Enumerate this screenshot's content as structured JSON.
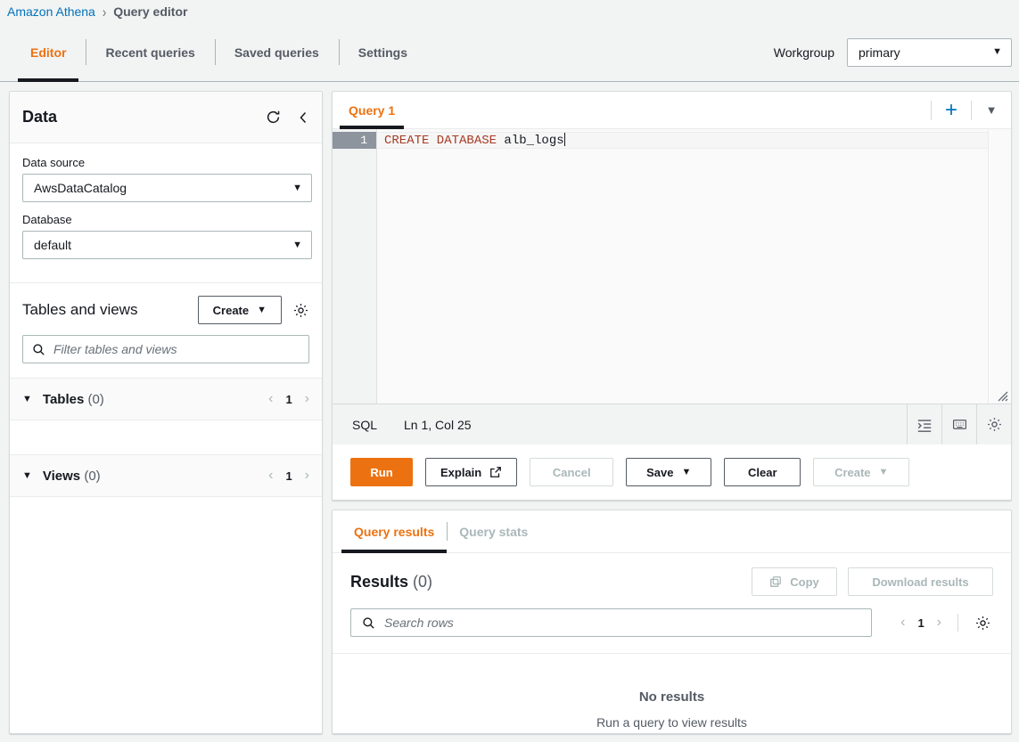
{
  "breadcrumb": {
    "root": "Amazon Athena",
    "separator": "›",
    "current": "Query editor"
  },
  "topbar": {
    "tabs": [
      {
        "label": "Editor",
        "active": true
      },
      {
        "label": "Recent queries",
        "active": false
      },
      {
        "label": "Saved queries",
        "active": false
      },
      {
        "label": "Settings",
        "active": false
      }
    ],
    "workgroup_label": "Workgroup",
    "workgroup_value": "primary"
  },
  "sidebar": {
    "title": "Data",
    "refresh_icon": "refresh-icon",
    "collapse_icon": "chevron-left-icon",
    "data_source_label": "Data source",
    "data_source_value": "AwsDataCatalog",
    "database_label": "Database",
    "database_value": "default",
    "tables_views_title": "Tables and views",
    "create_button": "Create",
    "settings_icon": "gear-icon",
    "filter_placeholder": "Filter tables and views",
    "groups": [
      {
        "name": "Tables",
        "count": "(0)",
        "page": "1"
      },
      {
        "name": "Views",
        "count": "(0)",
        "page": "1"
      }
    ]
  },
  "editor": {
    "tab_label": "Query 1",
    "add_tab_icon": "plus-icon",
    "tab_menu_icon": "chevron-down-icon",
    "line_number": "1",
    "code_keyword": "CREATE DATABASE ",
    "code_identifier": "alb_logs",
    "status_language": "SQL",
    "status_position": "Ln 1, Col 25",
    "status_icons": [
      "format-indent-icon",
      "keyboard-icon",
      "gear-icon"
    ]
  },
  "actions": {
    "run": "Run",
    "explain": "Explain",
    "explain_icon": "external-link-icon",
    "cancel": "Cancel",
    "save": "Save",
    "clear": "Clear",
    "create": "Create"
  },
  "results": {
    "tabs": [
      {
        "label": "Query results",
        "active": true,
        "disabled": false
      },
      {
        "label": "Query stats",
        "active": false,
        "disabled": true
      }
    ],
    "title": "Results",
    "count": "(0)",
    "copy_button": "Copy",
    "copy_icon": "copy-icon",
    "download_button": "Download results",
    "search_placeholder": "Search rows",
    "search_icon": "search-icon",
    "page": "1",
    "settings_icon": "gear-icon",
    "empty_title": "No results",
    "empty_subtitle": "Run a query to view results"
  },
  "colors": {
    "accent_orange": "#ec7211",
    "link_blue": "#0073bb",
    "text_dark": "#16191f",
    "text_muted": "#545b64",
    "disabled": "#aab7b8",
    "sql_keyword": "#a63b24"
  }
}
